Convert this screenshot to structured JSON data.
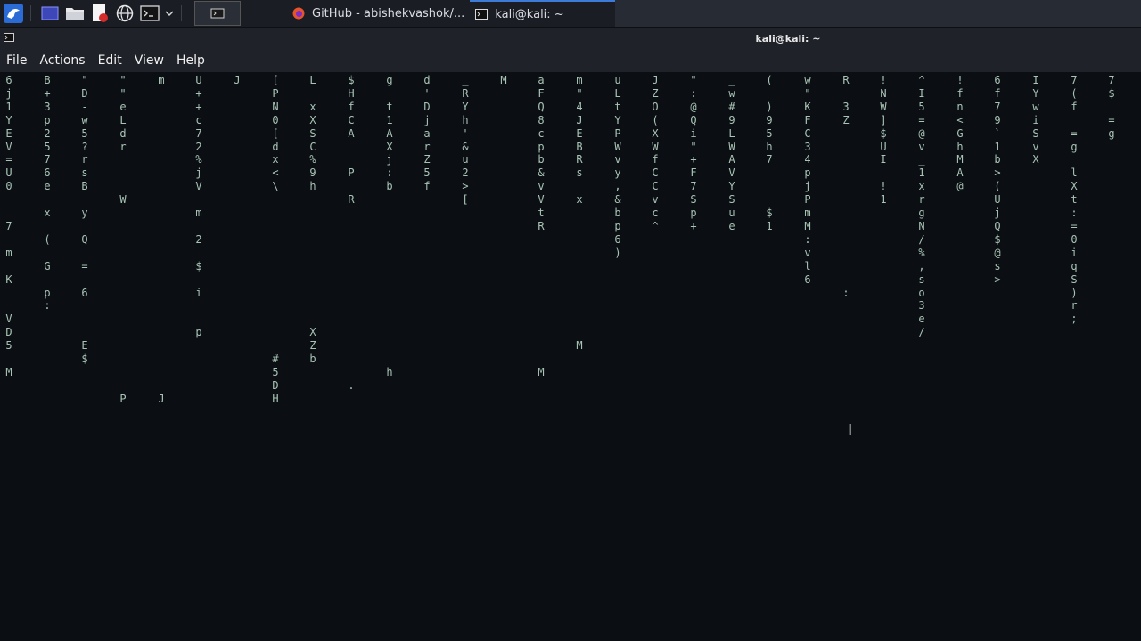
{
  "panel": {
    "tasks": [
      {
        "label": "GitHub - abishekvashok/...",
        "icon": "firefox-icon"
      },
      {
        "label": "kali@kali: ~",
        "icon": "terminal-icon"
      }
    ]
  },
  "window": {
    "title": "kali@kali: ~"
  },
  "menu": {
    "file": "File",
    "actions": "Actions",
    "edit": "Edit",
    "view": "View",
    "help": "Help"
  },
  "colors": {
    "rain": "#a8c4b4",
    "bright": "#e6fff2",
    "background": "#0b0e13"
  },
  "matrix": {
    "columns": [
      "6j1YEV=U0  7 m K  VD5 M",
      "B+3p2576e x ( G p:",
      "\"D-w5?rsB y Q = 6   E$",
      "\"\"eLdr   W              P",
      "m                       J",
      "U++c72%jV m 2 $ i  p",
      "J                      ",
      "[PN0[dx<\\            #5DH",
      "L xXSC%9h          XZb",
      "$HfCA  P R             .",
      "g t1AXj:b             h",
      "d'DjarZ5f",
      "_RYh'&u2>[",
      "M                     ",
      "aFQ8cpb&vVtR          M",
      "m\"4JEBRs x          M",
      "uLtYPWvy,&bp6)",
      "JZO(XWfCCvc^",
      "\":@Qi\"+F7Sp+",
      "_w#9LWAVYSue",
      "( )95h7   $1",
      "w\"KFC34pjPmM:vl6",
      "R 3Z            :",
      "!NW]$UI !1",
      "^I5=@v_1xrgN/%,so3e/",
      "!fn<GhMA@",
      "6f79`1b>(UjQ$@s>",
      "IYwiSvX",
      "7(f =g lXt:=0iqS)r;",
      "7$ =g"
    ]
  }
}
